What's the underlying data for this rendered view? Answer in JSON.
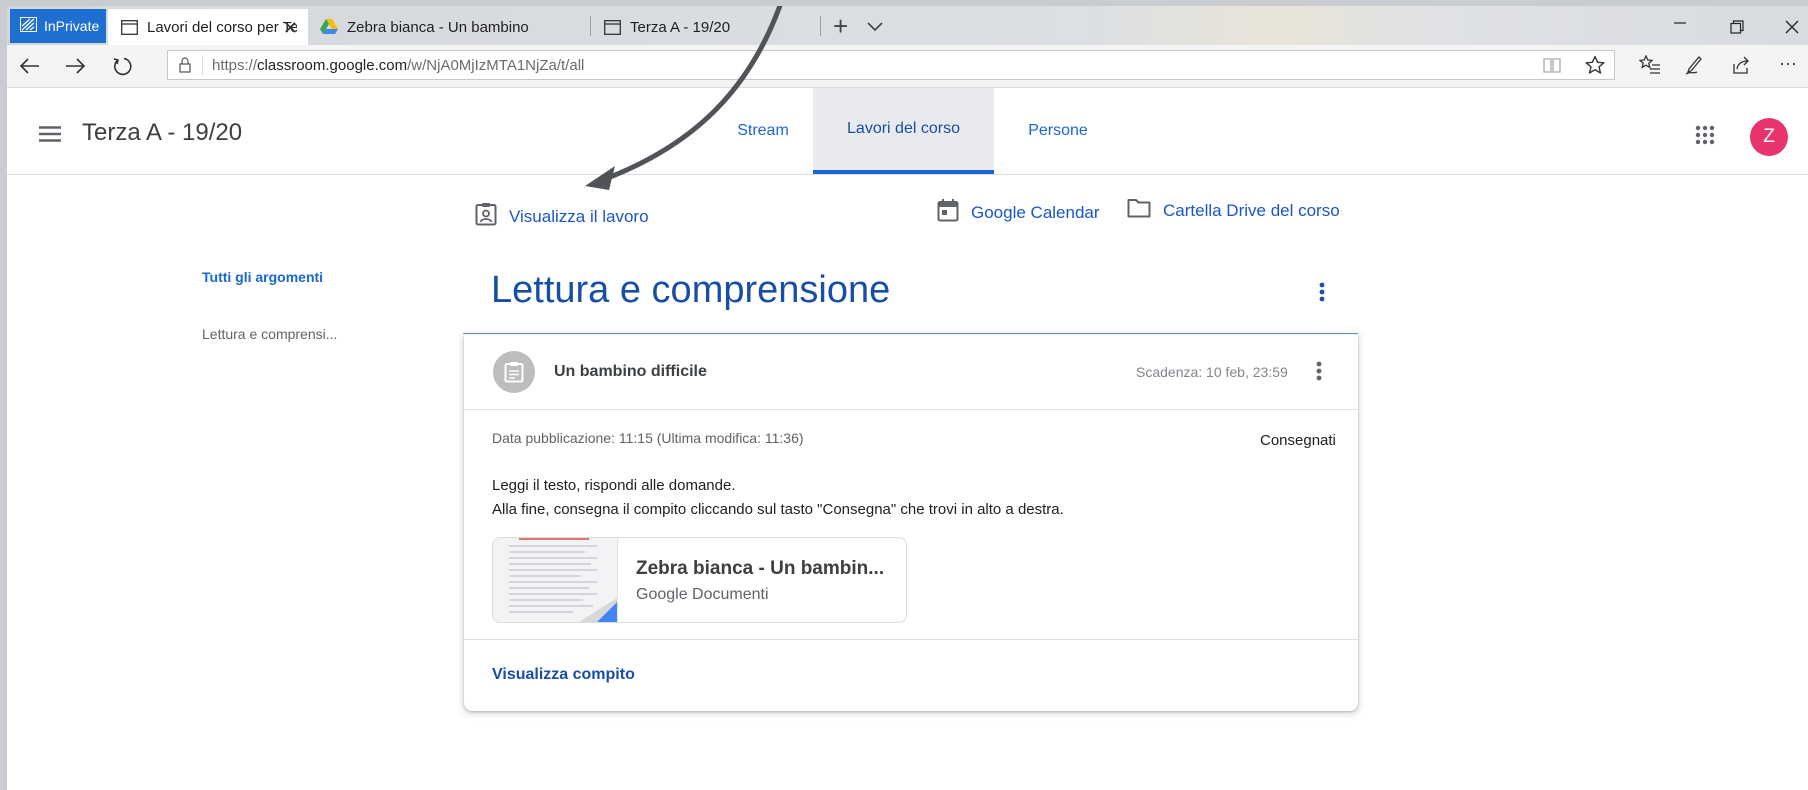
{
  "browser": {
    "inprivate_label": "InPrivate",
    "tabs": [
      {
        "label": "Lavori del corso per Ter.",
        "active": true
      },
      {
        "label": "Zebra bianca - Un bambino",
        "active": false
      },
      {
        "label": "Terza A - 19/20",
        "active": false
      }
    ],
    "url_prefix": "https://",
    "url_domain": "classroom.google.com",
    "url_path": "/w/NjA0MjIzMTA1NjZa/t/all"
  },
  "header": {
    "class_name": "Terza A - 19/20",
    "tabs": [
      {
        "label": "Stream"
      },
      {
        "label": "Lavori del corso"
      },
      {
        "label": "Persone"
      }
    ],
    "avatar_initial": "Z"
  },
  "actions": {
    "view_work": "Visualizza il lavoro",
    "calendar": "Google Calendar",
    "drive": "Cartella Drive del corso"
  },
  "sidebar": {
    "all_topics": "Tutti gli argomenti",
    "topic": "Lettura e comprensi..."
  },
  "topic": {
    "title": "Lettura e comprensione"
  },
  "assignment": {
    "title": "Un bambino difficile",
    "due": "Scadenza: 10 feb, 23:59",
    "posted": "Data pubblicazione: 11:15 (Ultima modifica: 11:36)",
    "status": "Consegnati",
    "description_line1": "Leggi il testo, rispondi alle domande.",
    "description_line2": "Alla fine, consegna il compito cliccando sul tasto \"Consegna\" che trovi in alto a destra.",
    "attachment_name": "Zebra bianca - Un bambin...",
    "attachment_type": "Google Documenti",
    "view_task": "Visualizza compito"
  },
  "colors": {
    "accent": "#1967d2",
    "title_blue": "#174ea6",
    "avatar": "#e8336c",
    "inprivate": "#1e6fd0"
  }
}
